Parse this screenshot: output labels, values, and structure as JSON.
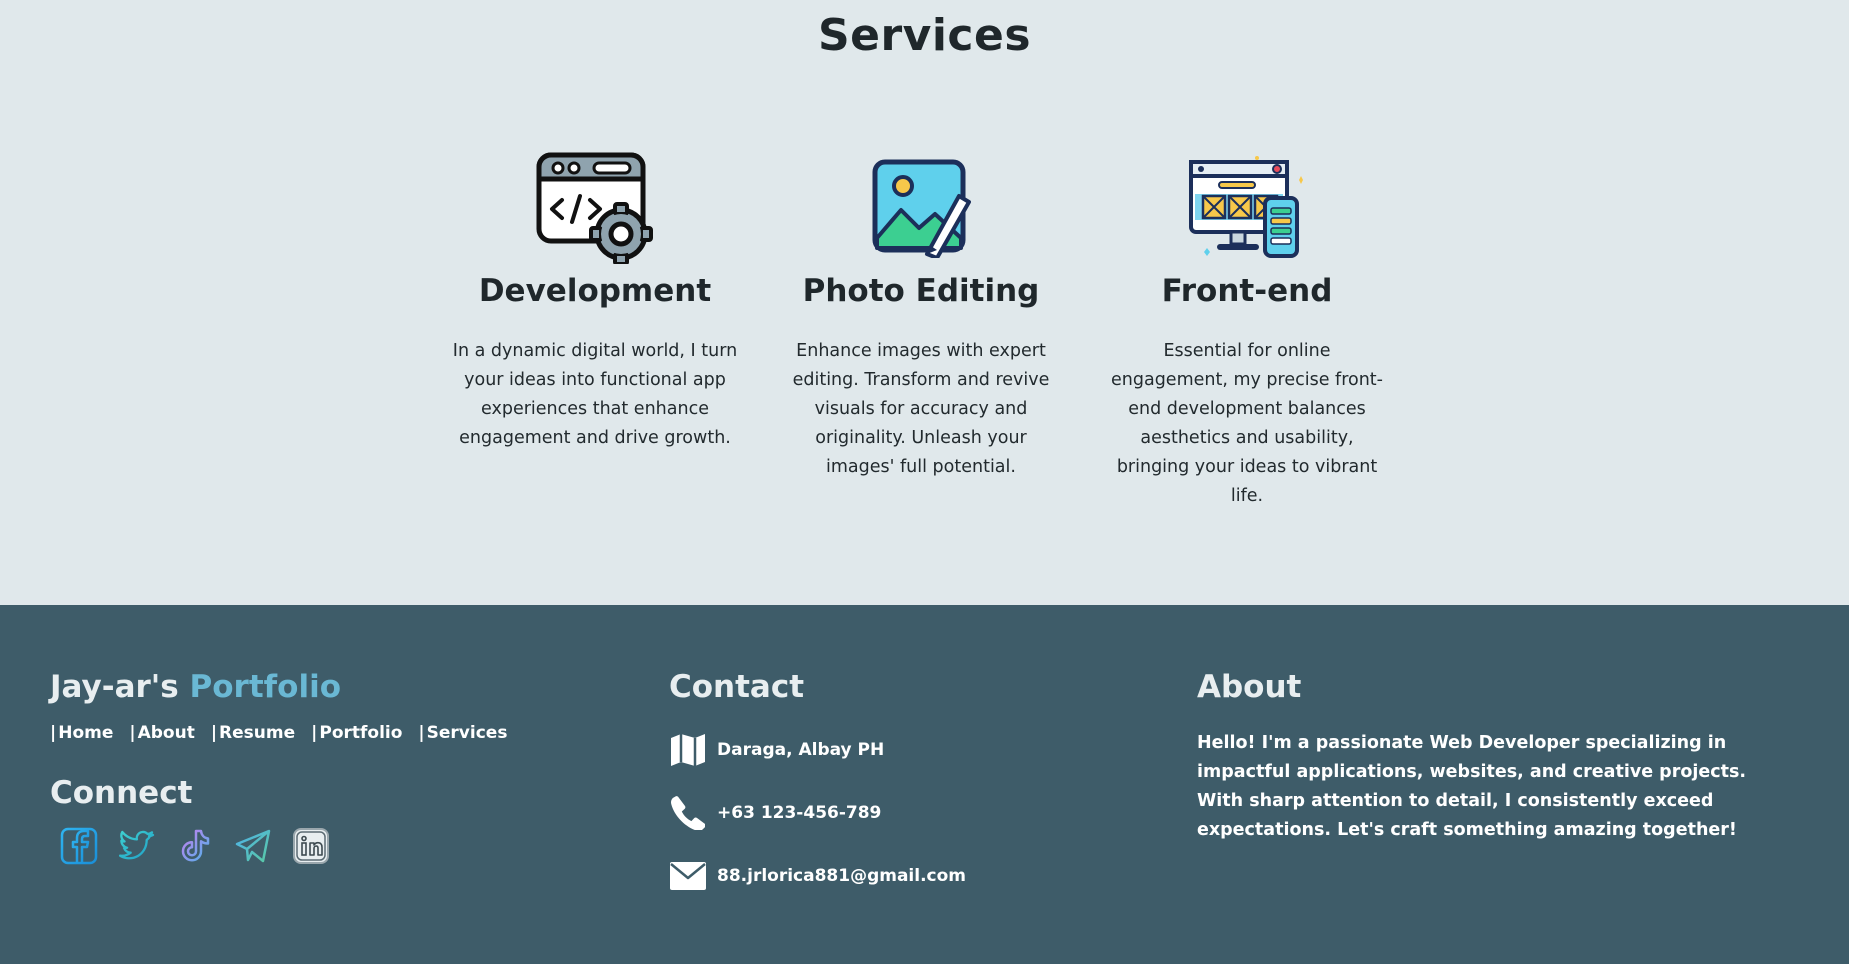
{
  "services": {
    "title": "Services",
    "items": [
      {
        "icon": "code-window-gear-icon",
        "title": "Development",
        "description": "In a dynamic digital world, I turn your ideas into functional app experiences that enhance engagement and drive growth."
      },
      {
        "icon": "image-edit-icon",
        "title": "Photo Editing",
        "description": "Enhance images with expert editing. Transform and revive visuals for accuracy and originality. Unleash your images' full potential."
      },
      {
        "icon": "monitor-phone-layout-icon",
        "title": "Front-end",
        "description": "Essential for online engagement, my precise front-end development balances aesthetics and usability, bringing your ideas to vibrant life."
      }
    ]
  },
  "footer": {
    "brand_name": "Jay-ar's",
    "brand_accent": "Portfolio",
    "nav_separator": "|",
    "nav": [
      "Home",
      "About",
      "Resume",
      "Portfolio",
      "Services"
    ],
    "connect_title": "Connect",
    "socials": [
      "facebook-icon",
      "twitter-icon",
      "tiktok-icon",
      "telegram-icon",
      "linkedin-icon"
    ],
    "contact_title": "Contact",
    "contact": {
      "address": "Daraga, Albay PH",
      "phone": "+63 123-456-789",
      "email": "88.jrlorica881@gmail.com"
    },
    "about_title": "About",
    "about_text": "Hello! I'm a passionate Web Developer specializing in impactful applications, websites, and creative projects. With sharp attention to detail, I consistently exceed expectations. Let's craft something amazing together!"
  },
  "colors": {
    "page_bg": "#e0e8eb",
    "footer_bg": "#3e5c69",
    "accent": "#6ab8d4",
    "heading": "#1f272b"
  }
}
